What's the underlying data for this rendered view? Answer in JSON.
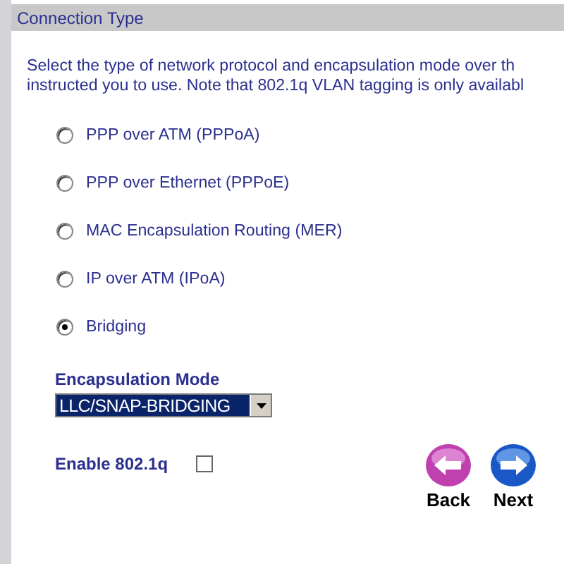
{
  "header": {
    "title": "Connection Type"
  },
  "intro_lines": [
    "Select the type of network protocol and encapsulation mode over th",
    "instructed you to use. Note that 802.1q VLAN tagging is only availabl"
  ],
  "options": [
    {
      "label": "PPP over ATM (PPPoA)",
      "selected": false
    },
    {
      "label": "PPP over Ethernet (PPPoE)",
      "selected": false
    },
    {
      "label": "MAC Encapsulation Routing (MER)",
      "selected": false
    },
    {
      "label": "IP over ATM (IPoA)",
      "selected": false
    },
    {
      "label": "Bridging",
      "selected": true
    }
  ],
  "encapsulation": {
    "label": "Encapsulation Mode",
    "value": "LLC/SNAP-BRIDGING"
  },
  "vlan": {
    "label": "Enable 802.1q",
    "checked": false
  },
  "buttons": [
    {
      "kind": "back",
      "label": "Back"
    },
    {
      "kind": "next",
      "label": "Next"
    }
  ]
}
